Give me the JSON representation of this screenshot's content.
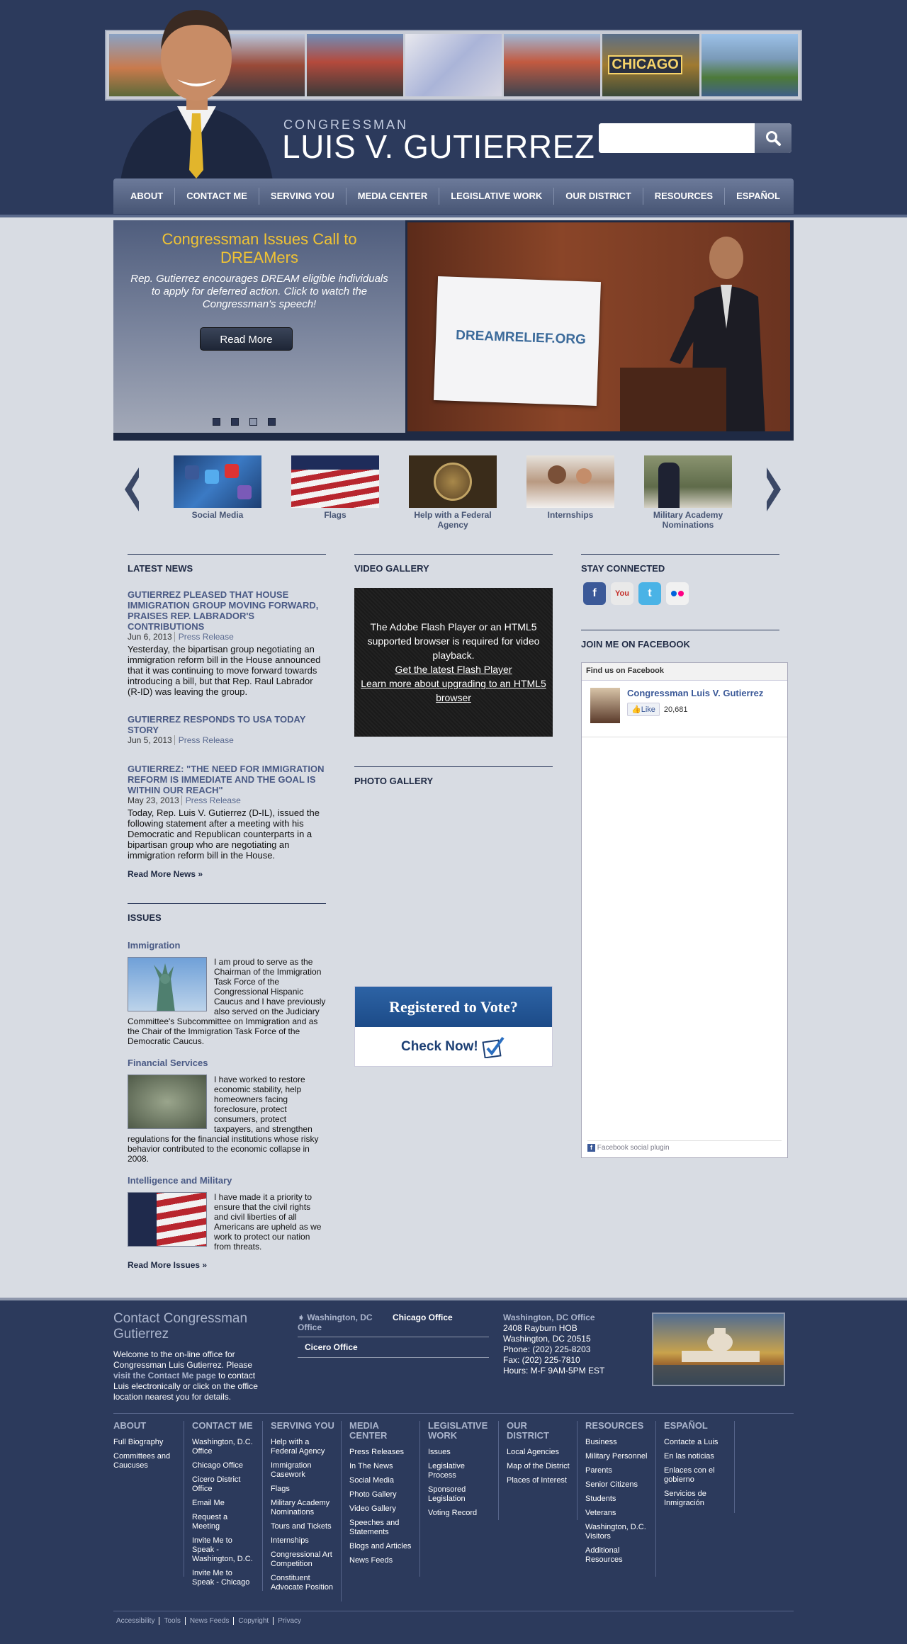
{
  "header": {
    "title_small": "CONGRESSMAN",
    "title_big": "LUIS V. GUTIERREZ",
    "banner_text": "CHICAGO",
    "search": {
      "placeholder": "",
      "value": ""
    }
  },
  "nav": [
    "ABOUT",
    "CONTACT ME",
    "SERVING YOU",
    "MEDIA CENTER",
    "LEGISLATIVE WORK",
    "OUR DISTRICT",
    "RESOURCES",
    "ESPAÑOL"
  ],
  "hero": {
    "title": "Congressman Issues Call to DREAMers",
    "description": "Rep. Gutierrez encourages DREAM eligible individuals to apply for deferred action. Click to watch the Congressman's speech!",
    "button": "Read More",
    "sign_text": "DREAMRELIEF.ORG",
    "active_slide": 3,
    "slide_count": 4
  },
  "quicklinks": [
    "Social Media",
    "Flags",
    "Help with a Federal Agency",
    "Internships",
    "Military Academy Nominations"
  ],
  "latest_news": {
    "heading": "LATEST NEWS",
    "items": [
      {
        "title": "GUTIERREZ PLEASED THAT HOUSE IMMIGRATION GROUP MOVING FORWARD, PRAISES REP. LABRADOR'S CONTRIBUTIONS",
        "date": "Jun 6, 2013",
        "type": "Press Release",
        "body": "Yesterday, the bipartisan group negotiating an immigration reform bill in the House announced that it was continuing to move forward towards introducing a bill, but that Rep. Raul Labrador (R-ID) was leaving the group."
      },
      {
        "title": "GUTIERREZ RESPONDS TO USA TODAY STORY",
        "date": "Jun 5, 2013",
        "type": "Press Release",
        "body": ""
      },
      {
        "title": "GUTIERREZ: \"THE NEED FOR IMMIGRATION REFORM IS IMMEDIATE AND THE GOAL IS WITHIN OUR REACH\"",
        "date": "May 23, 2013",
        "type": "Press Release",
        "body": "Today, Rep. Luis V. Gutierrez (D-IL), issued the following statement after a meeting with his Democratic and Republican counterparts in a bipartisan group who are negotiating an immigration reform bill in the House."
      }
    ],
    "more": "Read More News »"
  },
  "issues": {
    "heading": "ISSUES",
    "items": [
      {
        "title": "Immigration",
        "body": "I am proud to serve as the Chairman of the Immigration Task Force of the Congressional Hispanic Caucus and I have previously also served on the Judiciary Committee's Subcommittee on Immigration and as the Chair of the Immigration Task Force of the Democratic Caucus."
      },
      {
        "title": "Financial Services",
        "body": "I have worked to restore economic stability, help homeowners facing foreclosure, protect consumers, protect taxpayers, and strengthen regulations for the financial institutions whose risky behavior contributed to the economic collapse in 2008."
      },
      {
        "title": "Intelligence and Military",
        "body": "I have made it a priority to ensure that the civil rights and civil liberties of all Americans are upheld as we work to protect our nation from threats."
      }
    ],
    "more": "Read More Issues »"
  },
  "video": {
    "heading": "VIDEO GALLERY",
    "message": "The Adobe Flash Player or an HTML5 supported browser is required for video playback.",
    "link1": "Get the latest Flash Player",
    "link2": "Learn more about upgrading to an HTML5 browser"
  },
  "photo": {
    "heading": "PHOTO GALLERY"
  },
  "vote": {
    "title": "Registered to Vote?",
    "cta": "Check Now!"
  },
  "connected": {
    "heading": "STAY CONNECTED",
    "icons": [
      "facebook-icon",
      "youtube-icon",
      "twitter-icon",
      "flickr-icon"
    ]
  },
  "facebook": {
    "heading": "JOIN ME ON FACEBOOK",
    "box_title": "Find us on Facebook",
    "page_name": "Congressman Luis V. Gutierrez",
    "like": "Like",
    "count": "20,681",
    "plugin": "Facebook social plugin"
  },
  "footer": {
    "contact_title": "Contact Congressman Gutierrez",
    "contact_text_1": "Welcome to the on-line office for Congressman Luis Gutierrez. Please",
    "contact_link": "visit the Contact Me page",
    "contact_text_2": "to contact Luis electronically or click on the office location nearest you for details.",
    "offices": [
      "Washington, DC Office",
      "Chicago Office",
      "Cicero Office"
    ],
    "office_detail": {
      "name": "Washington, DC Office",
      "line1": "2408 Rayburn HOB",
      "line2": "Washington, DC 20515",
      "phone": "Phone: (202) 225-8203",
      "fax": "Fax: (202) 225-7810",
      "hours": "Hours: M-F 9AM-5PM EST"
    },
    "columns": [
      {
        "title": "ABOUT",
        "links": [
          "Full Biography",
          "Committees and Caucuses"
        ]
      },
      {
        "title": "CONTACT ME",
        "links": [
          "Washington, D.C. Office",
          "Chicago Office",
          "Cicero District Office",
          "Email Me",
          "Request a Meeting",
          "Invite Me to Speak - Washington, D.C.",
          "Invite Me to Speak - Chicago"
        ]
      },
      {
        "title": "SERVING YOU",
        "links": [
          "Help with a Federal Agency",
          "Immigration Casework",
          "Flags",
          "Military Academy Nominations",
          "Tours and Tickets",
          "Internships",
          "Congressional Art Competition",
          "Constituent Advocate Position"
        ]
      },
      {
        "title": "MEDIA CENTER",
        "links": [
          "Press Releases",
          "In The News",
          "Social Media",
          "Photo Gallery",
          "Video Gallery",
          "Speeches and Statements",
          "Blogs and Articles",
          "News Feeds"
        ]
      },
      {
        "title": "LEGISLATIVE WORK",
        "links": [
          "Issues",
          "Legislative Process",
          "Sponsored Legislation",
          "Voting Record"
        ]
      },
      {
        "title": "OUR DISTRICT",
        "links": [
          "Local Agencies",
          "Map of the District",
          "Places of Interest"
        ]
      },
      {
        "title": "RESOURCES",
        "links": [
          "Business",
          "Military Personnel",
          "Parents",
          "Senior Citizens",
          "Students",
          "Veterans",
          "Washington, D.C. Visitors",
          "Additional Resources"
        ]
      },
      {
        "title": "ESPAÑOL",
        "links": [
          "Contacte a Luis",
          "En las noticias",
          "Enlaces con el gobierno",
          "Servicios de Inmigración"
        ]
      }
    ],
    "bottom_links": [
      "Accessibility",
      "Tools",
      "News Feeds",
      "Copyright",
      "Privacy"
    ]
  },
  "colors": {
    "navy": "#2c3a5c",
    "accent_gold": "#f0c334",
    "link_blue": "#4a5a85"
  }
}
